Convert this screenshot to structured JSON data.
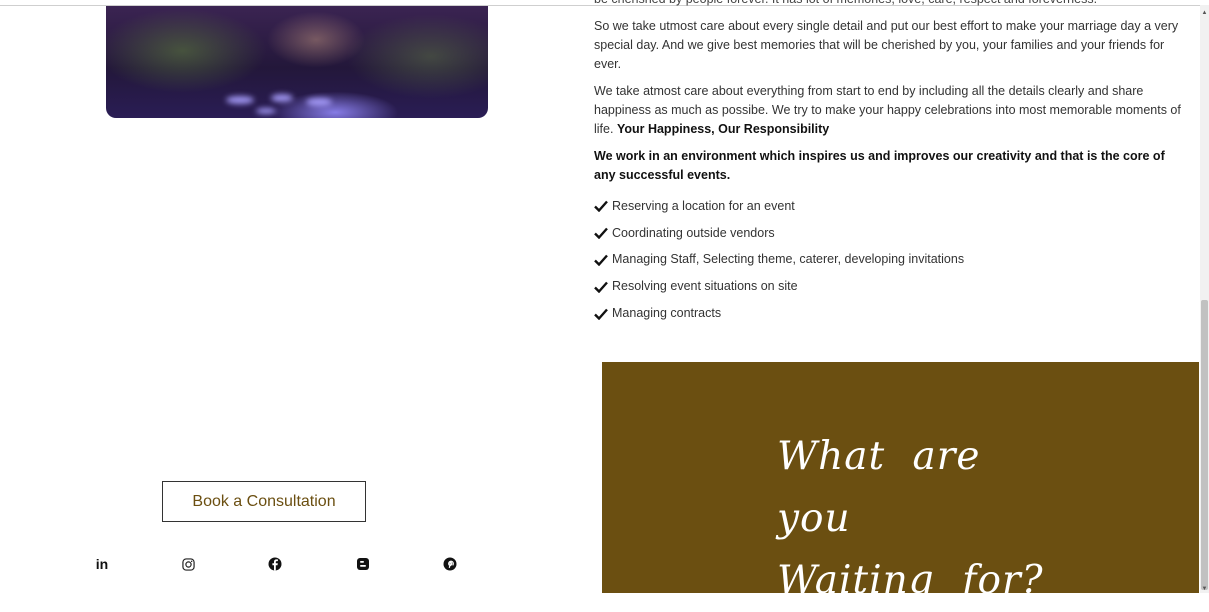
{
  "content": {
    "clipped_line": "be cherished by people forever. It has lot of memories, love, care, respect and foreverness.",
    "para1": "So we take utmost care about every single detail and put our best effort to make your marriage day a very special day. And we give best memories that will be cherished by you, your families and your friends for ever.",
    "para2_text": "We take atmost care about everything from start to end by including all the details clearly and share happiness as much as possibe. We try to make your happy celebrations into most memorable moments of life.",
    "para2_bold": "Your Happiness, Our Responsibility",
    "bold_statement": "We work in an environment which inspires us and improves our creativity and that is the core of any successful events.",
    "checklist": [
      "Reserving a location for an event",
      "Coordinating outside vendors",
      "Managing Staff, Selecting theme, caterer, developing invitations",
      "Resolving event situations on site",
      "Managing contracts"
    ]
  },
  "promo": {
    "line1": "What are you",
    "line2": "Waiting for?",
    "background": "#6b4f11"
  },
  "cta": {
    "book_label": "Book a Consultation",
    "text_color": "#6b4f11"
  },
  "socials": {
    "linkedin_label": "in",
    "items": [
      "linkedin-icon",
      "instagram-icon",
      "facebook-icon",
      "blogger-icon",
      "pinterest-icon"
    ]
  }
}
